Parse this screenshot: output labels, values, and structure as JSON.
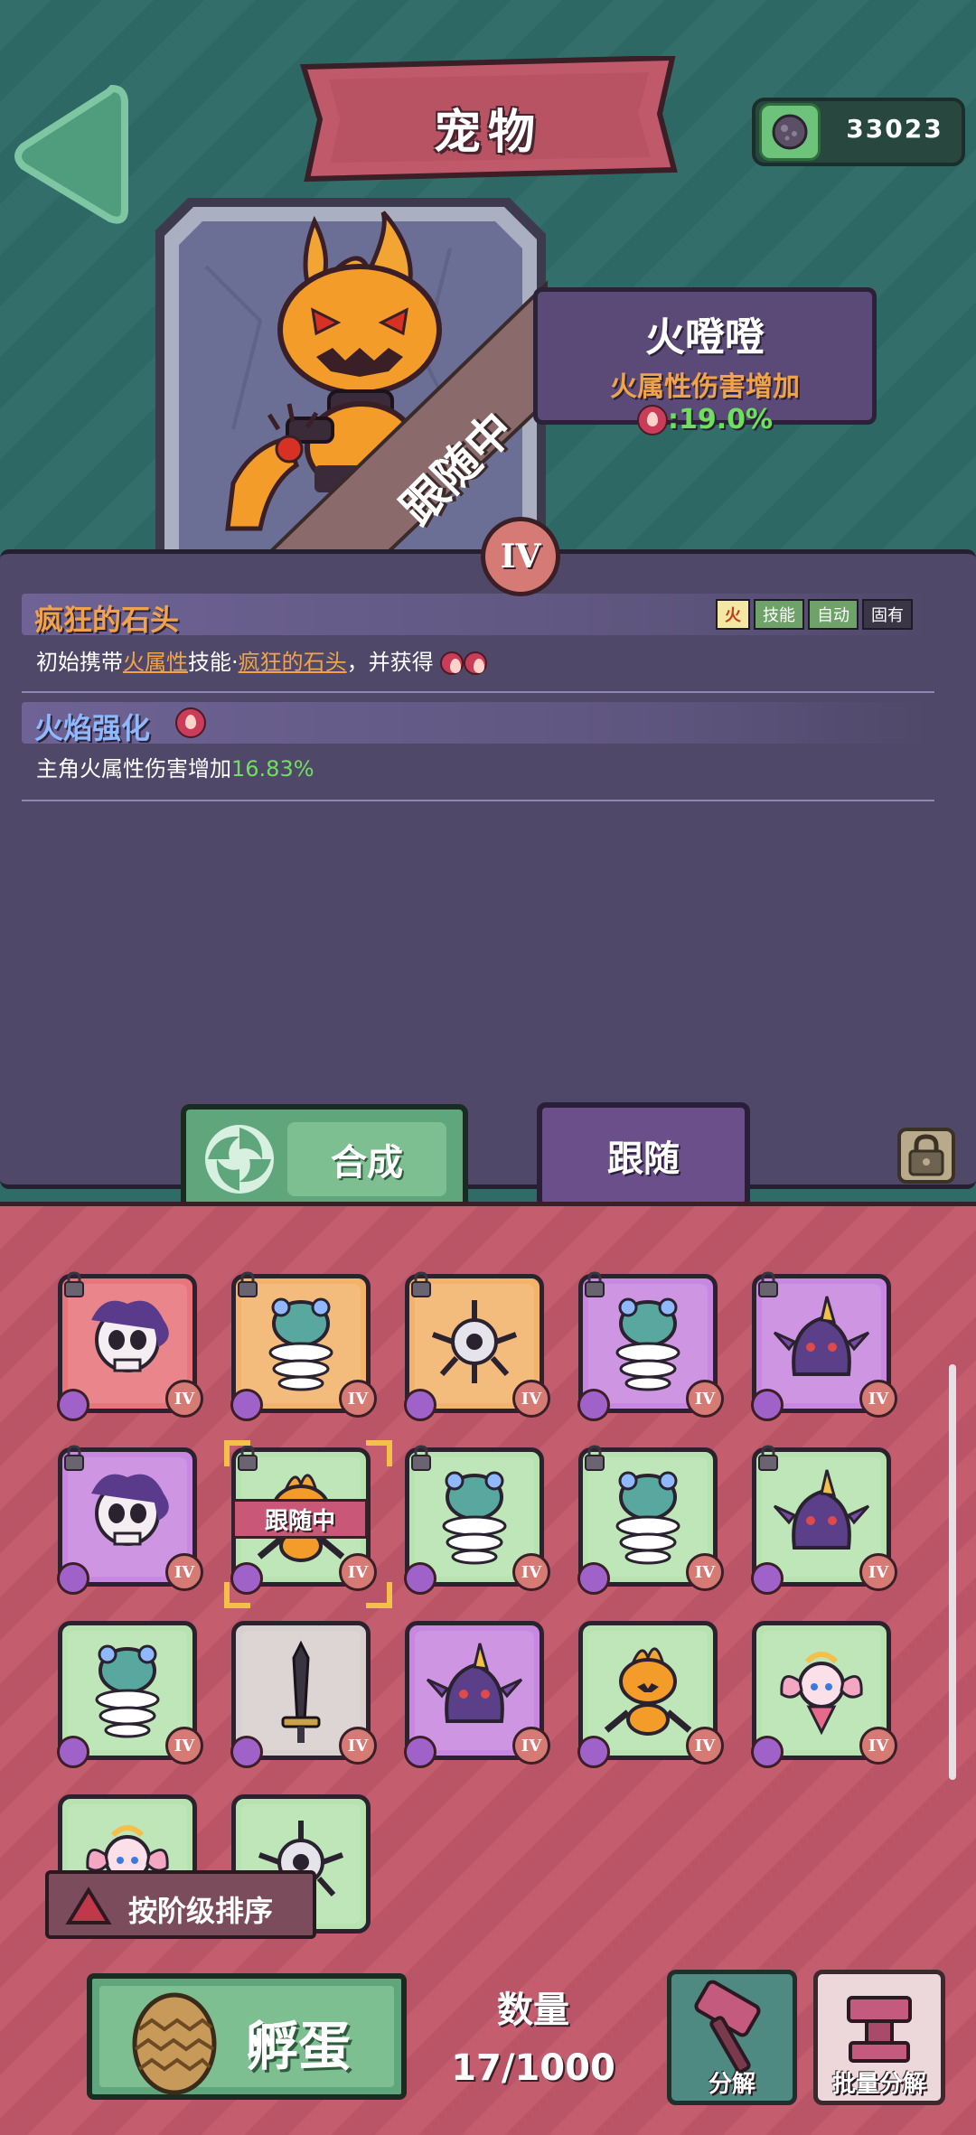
{
  "header": {
    "title": "宠物",
    "currency_value": "33023"
  },
  "pet": {
    "name": "火噔噔",
    "stat_label": "火属性伤害增加",
    "stat_value": ":19.0%",
    "status_ribbon": "跟随中",
    "rank": "IV"
  },
  "skills": [
    {
      "title": "疯狂的石头",
      "tags": [
        "火",
        "技能",
        "自动",
        "固有"
      ],
      "desc_prefix": "初始携带",
      "desc_hl1": "火属性",
      "desc_mid": "技能·",
      "desc_hl2": "疯狂的石头",
      "desc_suffix": "，并获得"
    },
    {
      "title": "火焰强化",
      "desc_prefix": "主角火属性伤害增加",
      "desc_value": "16.83%"
    }
  ],
  "tabs": {
    "synth_label": "合成",
    "follow_label": "跟随"
  },
  "grid": {
    "follow_tag": "跟随中",
    "slots": [
      {
        "level": "IV",
        "bg": "#e8757c",
        "creature": "skull"
      },
      {
        "level": "IV",
        "bg": "#f3b36a",
        "creature": "spring"
      },
      {
        "level": "IV",
        "bg": "#f3b36a",
        "creature": "orb"
      },
      {
        "level": "IV",
        "bg": "#c887e0",
        "creature": "spring"
      },
      {
        "level": "IV",
        "bg": "#c887e0",
        "creature": "ghost"
      },
      {
        "level": "IV",
        "bg": "#c887e0",
        "creature": "skull"
      },
      {
        "level": "IV",
        "bg": "#b7e3b0",
        "creature": "pumpkin"
      },
      {
        "level": "IV",
        "bg": "#b7e3b0",
        "creature": "spring"
      },
      {
        "level": "IV",
        "bg": "#b7e3b0",
        "creature": "spring"
      },
      {
        "level": "IV",
        "bg": "#b7e3b0",
        "creature": "ghost"
      },
      {
        "level": "IV",
        "bg": "#b7e3b0",
        "creature": "spring"
      },
      {
        "level": "IV",
        "bg": "#d8d0cf",
        "creature": "sword"
      },
      {
        "level": "IV",
        "bg": "#c887e0",
        "creature": "ghost"
      },
      {
        "level": "IV",
        "bg": "#b7e3b0",
        "creature": "pumpkin"
      },
      {
        "level": "IV",
        "bg": "#b7e3b0",
        "creature": "fairy"
      },
      {
        "level": "",
        "bg": "#b7e3b0",
        "creature": "fairy"
      },
      {
        "level": "",
        "bg": "#b7e3b0",
        "creature": "orb"
      }
    ]
  },
  "footer": {
    "sort_label": "按阶级排序",
    "hatch_label": "孵蛋",
    "count_label": "数量",
    "count_value": "17/1000",
    "decompose_label": "分解",
    "batch_label": "批量分解"
  },
  "colors": {
    "top_bg": "#2e6a66",
    "panel_bg": "#4f4868",
    "grid_bg": "#c05a6a",
    "accent_orange": "#f0a34a",
    "accent_green": "#6ee05e"
  }
}
